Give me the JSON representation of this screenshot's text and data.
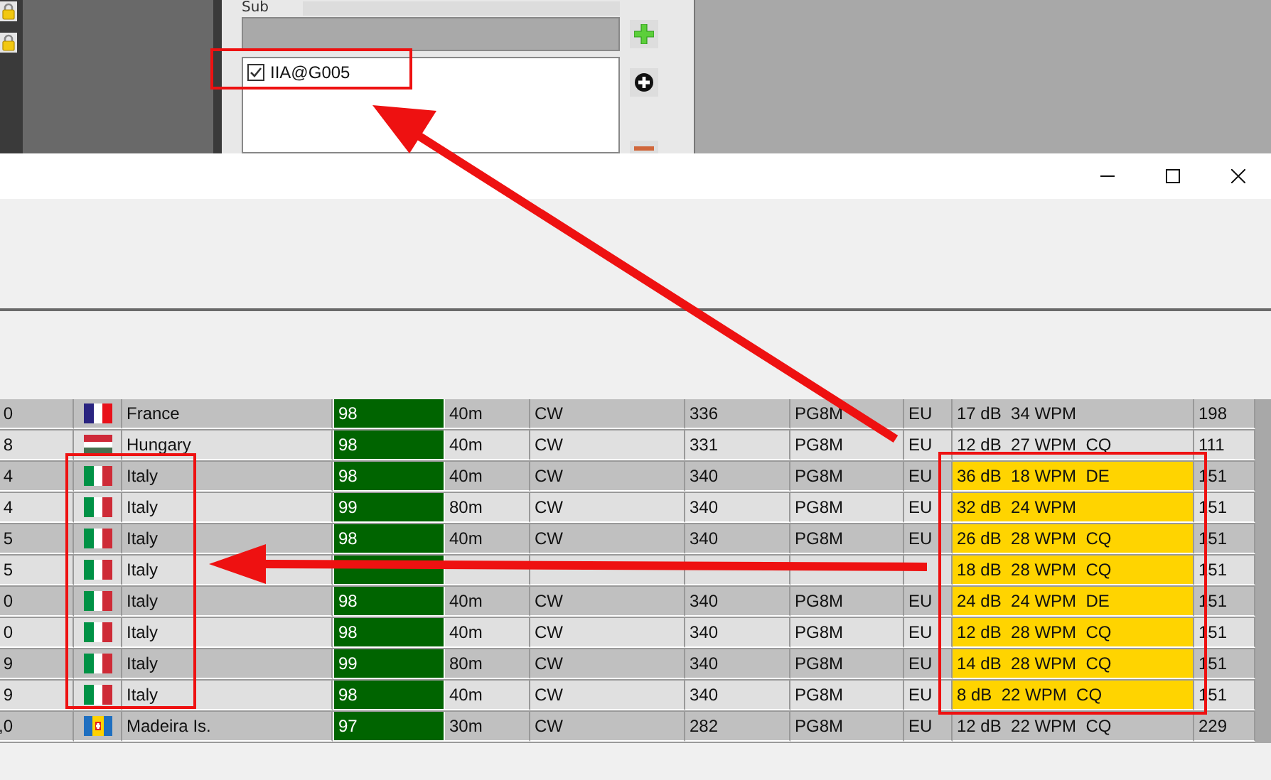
{
  "top_panel": {
    "sub_label": "Sub",
    "list_items": [
      {
        "label": "IIA@G005",
        "checked": true
      }
    ]
  },
  "spots": [
    {
      "col_1": "0",
      "kind": "france",
      "country": "France",
      "snr": "98",
      "band": "40m",
      "mode": "CW",
      "freq": "336",
      "call": "PG8M",
      "cont": "EU",
      "info": "17 dB  34 WPM",
      "last": "198",
      "highlight": false
    },
    {
      "col_1": "8",
      "kind": "hungary",
      "country": "Hungary",
      "snr": "98",
      "band": "40m",
      "mode": "CW",
      "freq": "331",
      "call": "PG8M",
      "cont": "EU",
      "info": "12 dB  27 WPM  CQ",
      "last": "111",
      "highlight": false
    },
    {
      "col_1": "4",
      "kind": "italy",
      "country": "Italy",
      "snr": "98",
      "band": "40m",
      "mode": "CW",
      "freq": "340",
      "call": "PG8M",
      "cont": "EU",
      "info": "36 dB  18 WPM  DE",
      "last": "151",
      "highlight": true
    },
    {
      "col_1": "4",
      "kind": "italy",
      "country": "Italy",
      "snr": "99",
      "band": "80m",
      "mode": "CW",
      "freq": "340",
      "call": "PG8M",
      "cont": "EU",
      "info": "32 dB  24 WPM",
      "last": "151",
      "highlight": true
    },
    {
      "col_1": "5",
      "kind": "italy",
      "country": "Italy",
      "snr": "98",
      "band": "40m",
      "mode": "CW",
      "freq": "340",
      "call": "PG8M",
      "cont": "EU",
      "info": "26 dB  28 WPM  CQ",
      "last": "151",
      "highlight": true
    },
    {
      "col_1": "5",
      "kind": "italy",
      "country": "Italy",
      "info": "18 dB  28 WPM  CQ",
      "last": "151",
      "highlight": true
    },
    {
      "col_1": "0",
      "kind": "italy",
      "country": "Italy",
      "snr": "98",
      "band": "40m",
      "mode": "CW",
      "freq": "340",
      "call": "PG8M",
      "cont": "EU",
      "info": "24 dB  24 WPM  DE",
      "last": "151",
      "highlight": true
    },
    {
      "col_1": "0",
      "kind": "italy",
      "country": "Italy",
      "snr": "98",
      "band": "40m",
      "mode": "CW",
      "freq": "340",
      "call": "PG8M",
      "cont": "EU",
      "info": "12 dB  28 WPM  CQ",
      "last": "151",
      "highlight": true
    },
    {
      "col_1": "9",
      "kind": "italy",
      "country": "Italy",
      "snr": "99",
      "band": "80m",
      "mode": "CW",
      "freq": "340",
      "call": "PG8M",
      "cont": "EU",
      "info": "14 dB  28 WPM  CQ",
      "last": "151",
      "highlight": true
    },
    {
      "col_1": "9",
      "kind": "italy",
      "country": "Italy",
      "snr": "98",
      "band": "40m",
      "mode": "CW",
      "freq": "340",
      "call": "PG8M",
      "cont": "EU",
      "info": "8 dB  22 WPM  CQ",
      "last": "151",
      "highlight": true
    },
    {
      "col_1": ",0",
      "kind": "madeira",
      "country": "Madeira Is.",
      "snr": "97",
      "band": "30m",
      "mode": "CW",
      "freq": "282",
      "call": "PG8M",
      "cont": "EU",
      "info": "12 dB  22 WPM  CQ",
      "last": "229",
      "highlight": false
    }
  ]
}
